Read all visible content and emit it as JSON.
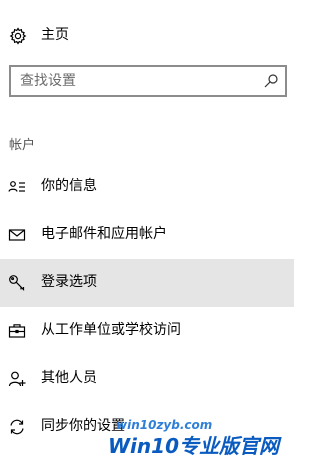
{
  "home": {
    "label": "主页",
    "icon": "gear-icon"
  },
  "search": {
    "placeholder": "查找设置",
    "value": "",
    "icon": "search-icon"
  },
  "section": {
    "title": "帐户"
  },
  "nav_items": [
    {
      "label": "你的信息",
      "icon": "user-info-icon",
      "selected": false
    },
    {
      "label": "电子邮件和应用帐户",
      "icon": "mail-icon",
      "selected": false
    },
    {
      "label": "登录选项",
      "icon": "key-icon",
      "selected": true
    },
    {
      "label": "从工作单位或学校访问",
      "icon": "briefcase-icon",
      "selected": false
    },
    {
      "label": "其他人员",
      "icon": "add-person-icon",
      "selected": false
    },
    {
      "label": "同步你的设置",
      "icon": "sync-icon",
      "selected": false
    }
  ],
  "watermark": {
    "brand": "Win10专业版官网",
    "url": "win10zyb.com"
  },
  "colors": {
    "selected_background": "#e5e5e5",
    "section_title": "#555555",
    "watermark_blue": "#0a5bbf"
  }
}
